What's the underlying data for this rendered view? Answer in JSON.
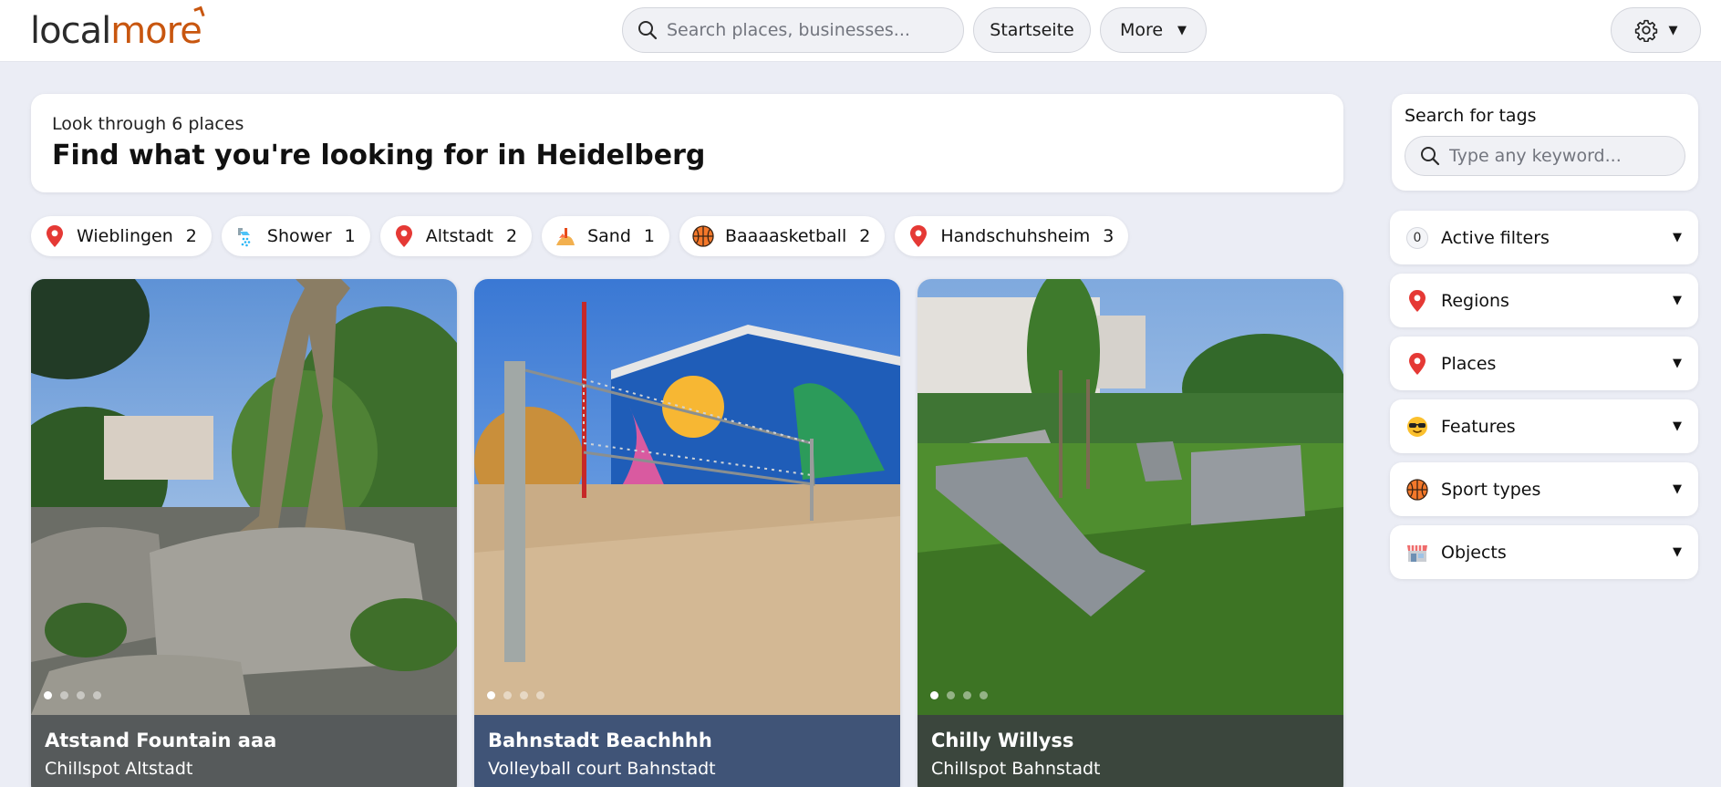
{
  "header": {
    "logo_left": "local",
    "logo_right": "more",
    "search_placeholder": "Search places, businesses...",
    "startseite_label": "Startseite",
    "more_label": "More"
  },
  "intro": {
    "subtitle": "Look through 6 places",
    "title": "Find what you're looking for in Heidelberg"
  },
  "tags": [
    {
      "label": "Wieblingen",
      "count": "2",
      "icon": "pin-icon"
    },
    {
      "label": "Shower",
      "count": "1",
      "icon": "shower-icon"
    },
    {
      "label": "Altstadt",
      "count": "2",
      "icon": "pin-icon"
    },
    {
      "label": "Sand",
      "count": "1",
      "icon": "sand-icon"
    },
    {
      "label": "Baaaasketball",
      "count": "2",
      "icon": "basketball-icon"
    },
    {
      "label": "Handschuhsheim",
      "count": "3",
      "icon": "pin-icon"
    }
  ],
  "cards": [
    {
      "title": "Atstand Fountain aaa",
      "subtitle": "Chillspot Altstadt"
    },
    {
      "title": "Bahnstadt Beachhhh",
      "subtitle": "Volleyball court Bahnstadt"
    },
    {
      "title": "Chilly Willyss",
      "subtitle": "Chillspot Bahnstadt"
    }
  ],
  "sidebar": {
    "tag_search_label": "Search for tags",
    "tag_search_placeholder": "Type any keyword...",
    "active_filters_count": "0",
    "filters": [
      {
        "label": "Active filters",
        "icon": "zero-badge"
      },
      {
        "label": "Regions",
        "icon": "pin-icon"
      },
      {
        "label": "Places",
        "icon": "pin-icon"
      },
      {
        "label": "Features",
        "icon": "sunglasses-face-icon"
      },
      {
        "label": "Sport types",
        "icon": "basketball-icon"
      },
      {
        "label": "Objects",
        "icon": "shop-icon"
      }
    ]
  },
  "colors": {
    "brand": "#c8560f",
    "background": "#ebedf5",
    "pin": "#e53935"
  }
}
